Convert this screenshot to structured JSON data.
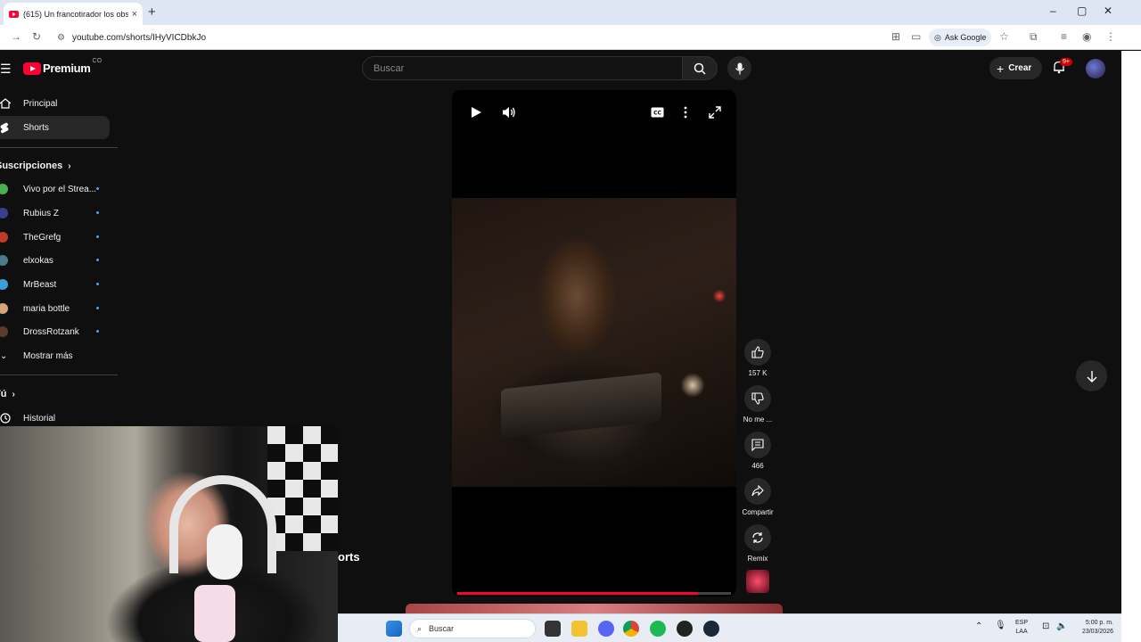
{
  "browser": {
    "tab_title": "(615) Un francotirador los obse",
    "tab_close": "×",
    "new_tab": "+",
    "url": "youtube.com/shorts/IHyVICDbkJo",
    "ask_google": "Ask Google",
    "window_controls": [
      "–",
      "▢",
      "✕"
    ]
  },
  "youtube": {
    "logo_text": "Premium",
    "country_code": "CO",
    "search_placeholder": "Buscar",
    "create_label": "Crear",
    "notifications_badge": "9+"
  },
  "sidebar": {
    "primary": [
      {
        "label": "Principal",
        "icon": "home-icon",
        "active": false
      },
      {
        "label": "Shorts",
        "icon": "shorts-icon",
        "active": true
      }
    ],
    "subscriptions_heading": "Suscripciones",
    "subscriptions": [
      {
        "label": "Vivo por el Strea...",
        "color": "#4caf50"
      },
      {
        "label": "Rubius Z",
        "color": "#3b3f8f"
      },
      {
        "label": "TheGrefg",
        "color": "#c0392b"
      },
      {
        "label": "elxokas",
        "color": "#4a7a8c"
      },
      {
        "label": "MrBeast",
        "color": "#3aa0d8"
      },
      {
        "label": "maria bottle",
        "color": "#d6a47a"
      },
      {
        "label": "DrossRotzank",
        "color": "#5a3b2a"
      }
    ],
    "show_more": "Mostrar más",
    "you_heading": "Tú",
    "history": "Historial"
  },
  "short": {
    "progress_percent": 88,
    "actions": [
      {
        "icon": "thumbs-up-icon",
        "label": "157 K"
      },
      {
        "icon": "thumbs-down-icon",
        "label": "No me ..."
      },
      {
        "icon": "comment-icon",
        "label": "466"
      },
      {
        "icon": "share-icon",
        "label": "Compartir"
      },
      {
        "icon": "remix-icon",
        "label": "Remix"
      }
    ],
    "partial_text": "orts"
  },
  "taskbar": {
    "search_label": "Buscar",
    "language_top": "ESP",
    "language_bottom": "LAA",
    "time": "5:00 p. m.",
    "date": "23/03/2026"
  },
  "colors": {
    "youtube_red": "#ff0033",
    "background": "#0f0f0f",
    "chip": "#272727"
  }
}
